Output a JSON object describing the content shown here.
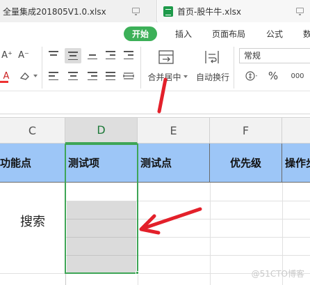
{
  "tabs": [
    {
      "label": "全量集成201805V1.0.xlsx"
    },
    {
      "label": "首页-股牛牛.xlsx"
    }
  ],
  "menu": {
    "home": "开始",
    "insert": "插入",
    "page_layout": "页面布局",
    "formula": "公式",
    "more": "数"
  },
  "toolbar": {
    "font_grow": "A⁺",
    "font_shrink": "A⁻",
    "merge_center": "合并居中",
    "wrap_text": "自动换行",
    "number_format": "常规",
    "percent": "%",
    "thousands": "000"
  },
  "columns": [
    "C",
    "D",
    "E",
    "F"
  ],
  "header_row": [
    "功能点",
    "测试项",
    "测试点",
    "优先级",
    "操作步"
  ],
  "cells": {
    "c_merged": "搜索"
  },
  "watermark": "@51CTO博客",
  "colors": {
    "accent_green": "#3cb058",
    "header_blue": "#9dc6f7",
    "selection_border": "#3ea556",
    "selection_fill": "#dbdbdb",
    "annotation_red": "#e3202a"
  }
}
